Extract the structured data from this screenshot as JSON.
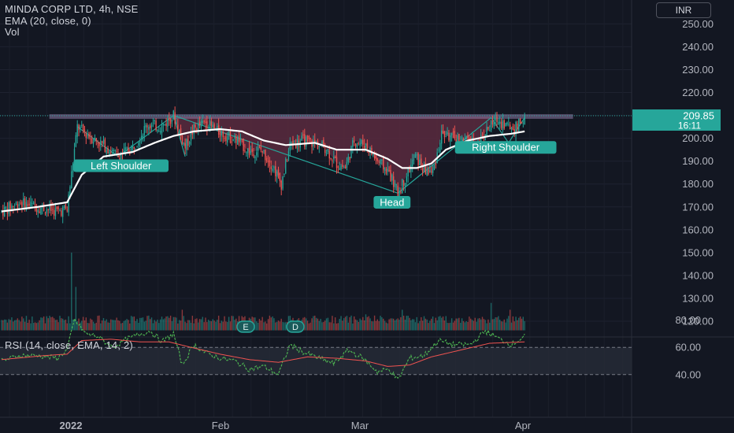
{
  "legend": {
    "symbol": "MINDA CORP LTD, 4h, NSE",
    "ema": "EMA (20, close, 0)",
    "vol": "Vol",
    "rsi": "RSI (14, close, EMA, 14, 2)"
  },
  "currency": "INR",
  "last_price": {
    "value": "209.85",
    "countdown": "16:11",
    "color": "#26a69a"
  },
  "colors": {
    "up": "#26a69a",
    "down": "#ef5350",
    "ema": "#ffffff",
    "rsi": "#4caf50",
    "rsi_ma": "#ef5350",
    "pattern": "#5b2a3e",
    "neckline": "#8e7aa5"
  },
  "chart_data": {
    "type": "candlestick",
    "x_ticks": [
      "2022",
      "Feb",
      "Mar",
      "Apr"
    ],
    "price_axis": {
      "ticks": [
        250,
        240,
        230,
        220,
        210,
        200,
        190,
        180,
        170,
        160,
        150,
        140,
        130,
        120
      ],
      "ylim": [
        116,
        255
      ]
    },
    "rsi_axis": {
      "ticks": [
        80,
        60,
        40
      ],
      "band": [
        40,
        60
      ],
      "ylim": [
        25,
        85
      ]
    },
    "annotations": [
      "Left Shoulder",
      "Head",
      "Right Shoulder"
    ],
    "volume_markers": [
      "E",
      "D"
    ],
    "price_anchors": [
      [
        0,
        168
      ],
      [
        12,
        172
      ],
      [
        25,
        170
      ],
      [
        38,
        168
      ],
      [
        45,
        169
      ],
      [
        52,
        205
      ],
      [
        60,
        201
      ],
      [
        70,
        197
      ],
      [
        80,
        192
      ],
      [
        90,
        196
      ],
      [
        100,
        206
      ],
      [
        110,
        205
      ],
      [
        118,
        210
      ],
      [
        126,
        196
      ],
      [
        132,
        204
      ],
      [
        140,
        207
      ],
      [
        148,
        203
      ],
      [
        155,
        201
      ],
      [
        162,
        199
      ],
      [
        170,
        194
      ],
      [
        178,
        195
      ],
      [
        186,
        188
      ],
      [
        192,
        180
      ],
      [
        198,
        197
      ],
      [
        206,
        199
      ],
      [
        214,
        198
      ],
      [
        222,
        196
      ],
      [
        230,
        189
      ],
      [
        236,
        187
      ],
      [
        242,
        199
      ],
      [
        250,
        197
      ],
      [
        258,
        190
      ],
      [
        266,
        185
      ],
      [
        272,
        176
      ],
      [
        278,
        184
      ],
      [
        284,
        192
      ],
      [
        290,
        186
      ],
      [
        296,
        185
      ],
      [
        302,
        202
      ],
      [
        310,
        200
      ],
      [
        318,
        199
      ],
      [
        326,
        198
      ],
      [
        334,
        204
      ],
      [
        340,
        208
      ],
      [
        346,
        206
      ],
      [
        352,
        204
      ],
      [
        359,
        209
      ]
    ],
    "ema_anchors": [
      [
        0,
        168
      ],
      [
        25,
        170
      ],
      [
        45,
        172
      ],
      [
        55,
        184
      ],
      [
        70,
        192
      ],
      [
        90,
        194
      ],
      [
        105,
        198
      ],
      [
        118,
        201
      ],
      [
        132,
        203
      ],
      [
        150,
        204
      ],
      [
        165,
        203
      ],
      [
        180,
        199
      ],
      [
        195,
        197
      ],
      [
        215,
        198
      ],
      [
        230,
        195
      ],
      [
        250,
        195
      ],
      [
        265,
        191
      ],
      [
        275,
        187
      ],
      [
        285,
        187
      ],
      [
        295,
        189
      ],
      [
        305,
        195
      ],
      [
        320,
        199
      ],
      [
        335,
        201
      ],
      [
        350,
        202
      ],
      [
        359,
        203
      ]
    ],
    "rsi_anchors": [
      [
        0,
        50
      ],
      [
        12,
        54
      ],
      [
        25,
        54
      ],
      [
        38,
        52
      ],
      [
        45,
        58
      ],
      [
        50,
        80
      ],
      [
        58,
        70
      ],
      [
        66,
        68
      ],
      [
        76,
        60
      ],
      [
        86,
        66
      ],
      [
        96,
        70
      ],
      [
        102,
        72
      ],
      [
        110,
        64
      ],
      [
        118,
        70
      ],
      [
        124,
        47
      ],
      [
        132,
        62
      ],
      [
        140,
        56
      ],
      [
        150,
        52
      ],
      [
        160,
        50
      ],
      [
        170,
        44
      ],
      [
        180,
        46
      ],
      [
        190,
        40
      ],
      [
        198,
        62
      ],
      [
        208,
        56
      ],
      [
        218,
        52
      ],
      [
        228,
        48
      ],
      [
        238,
        58
      ],
      [
        248,
        52
      ],
      [
        258,
        42
      ],
      [
        266,
        44
      ],
      [
        272,
        36
      ],
      [
        280,
        52
      ],
      [
        290,
        54
      ],
      [
        300,
        65
      ],
      [
        310,
        62
      ],
      [
        322,
        62
      ],
      [
        332,
        72
      ],
      [
        342,
        66
      ],
      [
        350,
        62
      ],
      [
        359,
        68
      ]
    ],
    "rsi_ma_anchors": [
      [
        0,
        51
      ],
      [
        30,
        54
      ],
      [
        45,
        55
      ],
      [
        55,
        65
      ],
      [
        75,
        66
      ],
      [
        95,
        64
      ],
      [
        115,
        64
      ],
      [
        130,
        60
      ],
      [
        150,
        55
      ],
      [
        170,
        51
      ],
      [
        190,
        49
      ],
      [
        210,
        53
      ],
      [
        230,
        52
      ],
      [
        250,
        50
      ],
      [
        265,
        46
      ],
      [
        280,
        47
      ],
      [
        295,
        53
      ],
      [
        315,
        58
      ],
      [
        335,
        63
      ],
      [
        359,
        64
      ]
    ],
    "volume_spikes": [
      [
        48,
        150
      ],
      [
        51,
        135
      ],
      [
        110,
        122
      ],
      [
        124,
        125
      ],
      [
        250,
        123
      ],
      [
        275,
        125
      ],
      [
        300,
        122
      ],
      [
        336,
        128
      ],
      [
        349,
        125
      ]
    ]
  }
}
